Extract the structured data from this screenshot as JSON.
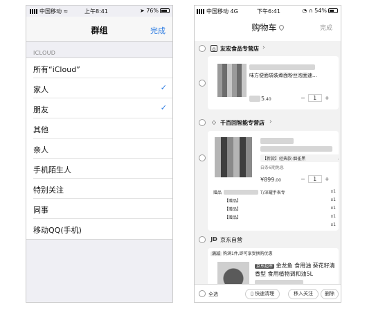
{
  "left": {
    "status": {
      "carrier": "中国移动",
      "time": "上午8:41",
      "battery": "76%"
    },
    "nav": {
      "title": "群组",
      "done": "完成"
    },
    "section": "ICLOUD",
    "groups": [
      {
        "label": "所有“iCloud”",
        "checked": false
      },
      {
        "label": "家人",
        "checked": true
      },
      {
        "label": "朋友",
        "checked": true
      },
      {
        "label": "其他",
        "checked": false
      },
      {
        "label": "亲人",
        "checked": false
      },
      {
        "label": "手机陌生人",
        "checked": false
      },
      {
        "label": "特别关注",
        "checked": false
      },
      {
        "label": "同事",
        "checked": false
      },
      {
        "label": "移动QQ(手机)",
        "checked": false
      }
    ],
    "check_glyph": "✓"
  },
  "right": {
    "status": {
      "carrier": "中国移动",
      "network": "4G",
      "time": "下午6:41",
      "battery": "54%"
    },
    "title": "购物车",
    "done": "完成",
    "stores": [
      {
        "name": "友宏食品专营店"
      },
      {
        "name": "千百回智能专营店"
      },
      {
        "name": "京东自营",
        "logo": "JD"
      }
    ],
    "item1": {
      "title": "味方便面袋装煮面粉丝泡面速...",
      "price": "5",
      "price_dec": ".40",
      "qty": "1"
    },
    "item2": {
      "spec": "【新款】经典款-烟雀黑",
      "installment": "白条6期免息",
      "price": "¥899",
      "price_dec": ".00",
      "qty": "1",
      "gift_label": "赠品",
      "gift_text": "T/深耀手表专",
      "gift_prefix": "【赠品】",
      "gift_count": "x1"
    },
    "promo": {
      "badge": "满减",
      "text": "购满1件,即可享受换购优惠"
    },
    "item3": {
      "badge": "京东超市",
      "title_line1": "金龙鱼 食用油 葵花籽清",
      "title_line2": "香型 食用植物调和油5L"
    },
    "bottom": {
      "select_all": "全选",
      "quick_clean": "快速清理",
      "move_follow": "移入关注",
      "delete": "删除"
    }
  }
}
